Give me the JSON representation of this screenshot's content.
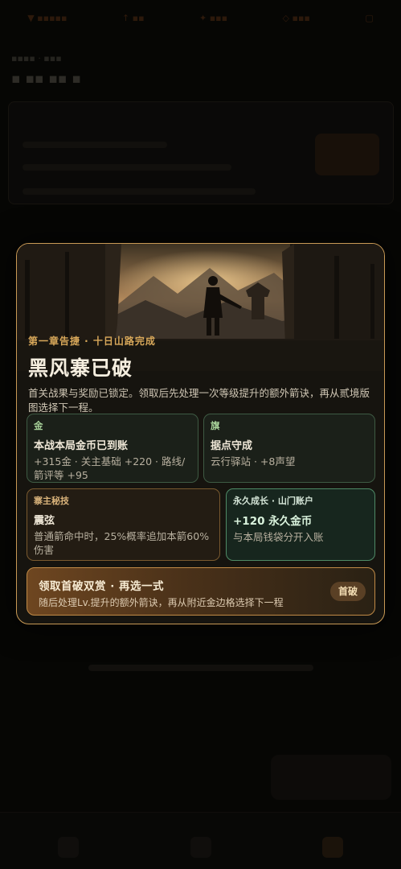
{
  "modal": {
    "kicker": "第一章告捷 · 十日山路完成",
    "title": "黑风寨已破",
    "description": "首关战果与奖励已锁定。领取后先处理一次等级提升的额外箭诀，再从贰境版图选择下一程。",
    "cards": {
      "gold": {
        "tag": "金",
        "title": "本战本局金币已到账",
        "detail": "+315金 · 关主基础 +220 · 路线/箭评等 +95"
      },
      "flag": {
        "tag": "旗",
        "title": "据点守成",
        "detail": "云行驿站 · +8声望"
      },
      "skill": {
        "tag": "寨主秘技",
        "title": "震弦",
        "detail": "普通箭命中时，25%概率追加本箭60%伤害"
      },
      "permanent": {
        "tag": "永久成长 · 山门账户",
        "title": "+120 永久金币",
        "detail": "与本局钱袋分开入账"
      }
    },
    "claim": {
      "title": "领取首破双赏 · 再选一式",
      "subtitle": "随后处理Lv.提升的额外箭诀，再从附近金边格选择下一程",
      "badge": "首破"
    }
  },
  "colors": {
    "modal_border": "#c99a55",
    "kicker": "#d8a85a",
    "reward_green": "#a8d39a",
    "claim_gradient_start": "#6e4620"
  }
}
